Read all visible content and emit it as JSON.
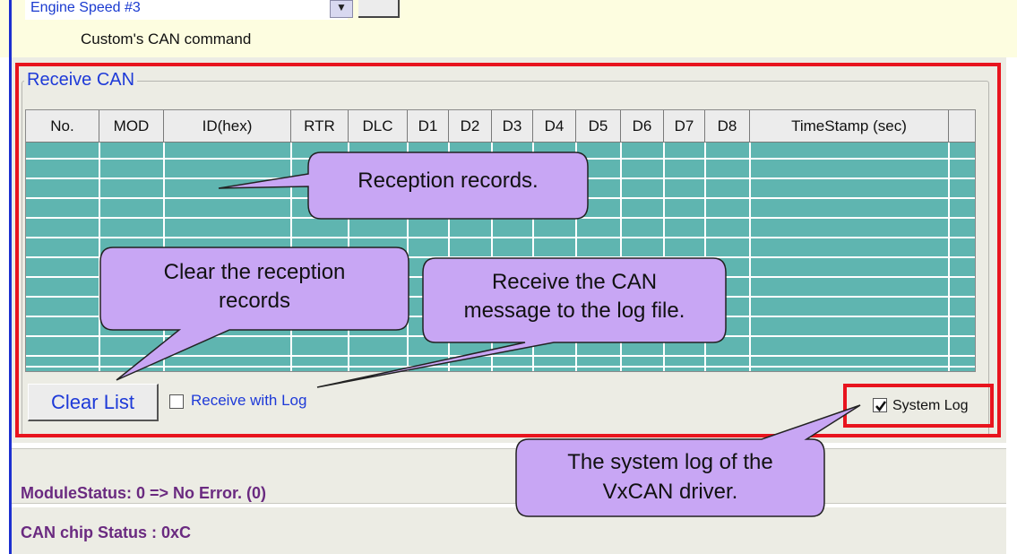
{
  "top": {
    "dropdown_value": "Engine Speed #3",
    "command_label": "Custom's CAN command"
  },
  "receive": {
    "group_title": "Receive CAN",
    "columns": [
      "No.",
      "MOD",
      "ID(hex)",
      "RTR",
      "DLC",
      "D1",
      "D2",
      "D3",
      "D4",
      "D5",
      "D6",
      "D7",
      "D8",
      "TimeStamp (sec)"
    ],
    "clear_button": "Clear List",
    "receive_with_log_label": "Receive with Log",
    "receive_with_log_checked": false,
    "system_log_label": "System Log",
    "system_log_checked": true
  },
  "status": {
    "module_status": "ModuleStatus: 0 => No Error. (0)",
    "can_chip_status": "CAN chip Status : 0xC"
  },
  "callouts": {
    "reception_records": "Reception records.",
    "clear_records_line1": "Clear the reception",
    "clear_records_line2": "records",
    "receive_log_line1": "Receive the CAN",
    "receive_log_line2": "message to the log file.",
    "system_log_line1": "The system log of the",
    "system_log_line2": "VxCAN driver."
  },
  "colors": {
    "grid_fill": "#5fb5b0",
    "callout_fill": "#c8a6f4",
    "highlight_red": "#e8141e",
    "label_blue": "#1e3ad8",
    "status_purple": "#6a2a80"
  }
}
